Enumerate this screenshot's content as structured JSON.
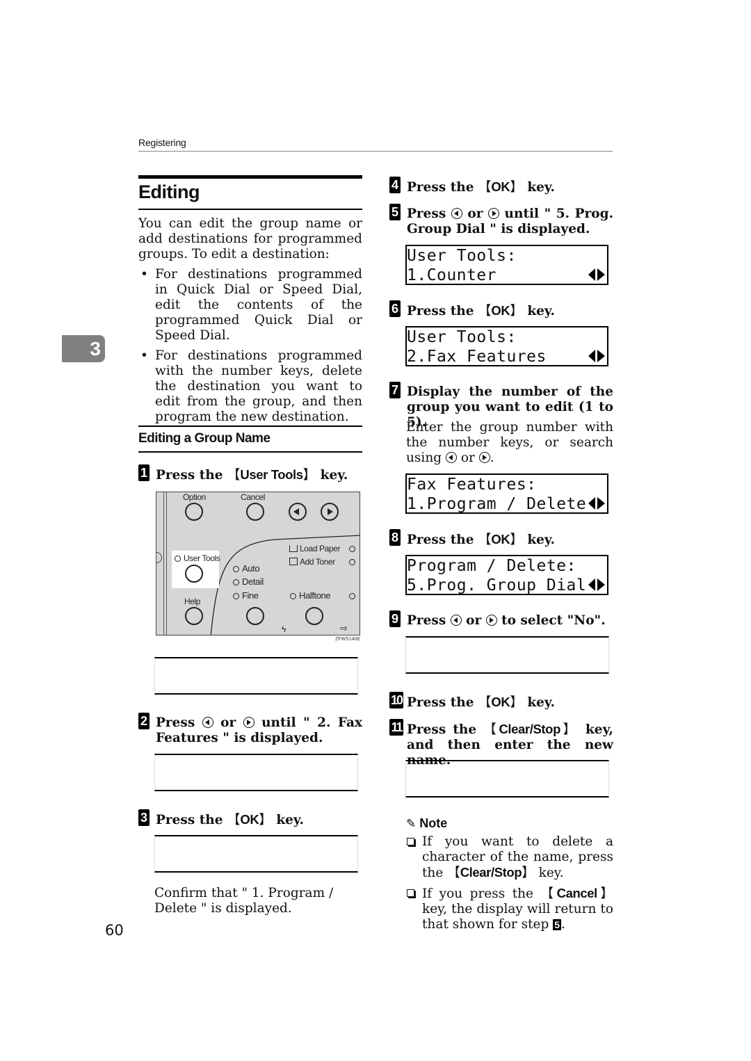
{
  "header": {
    "running_head": "Registering"
  },
  "chapter_tab": "3",
  "section": {
    "title": "Editing",
    "intro": "You can edit the group name or add destinations for programmed groups. To edit a destination:",
    "bullets": [
      "For destinations programmed in Quick Dial or Speed Dial, edit the contents of the programmed Quick Dial or Speed Dial.",
      "For destinations programmed with the number keys, delete the destination you want to edit from the group, and then program the new destination."
    ]
  },
  "subsection": {
    "title": "Editing a Group Name"
  },
  "keys": {
    "user_tools": "User Tools",
    "ok": "OK",
    "clear_stop": "Clear/Stop",
    "cancel": "Cancel",
    "bracket_open": "【",
    "bracket_close": "】"
  },
  "steps": [
    {
      "num": "1",
      "pre": "Press the ",
      "key": "User Tools",
      "post": " key."
    },
    {
      "num": "2",
      "pre": "Press ",
      "mid": " or ",
      "post": " until \" 2. Fax Features \" is displayed."
    },
    {
      "num": "3",
      "pre": "Press the ",
      "key": "OK",
      "post": " key.",
      "note": "Confirm that \" 1. Program / Delete \" is displayed."
    },
    {
      "num": "4",
      "pre": "Press the ",
      "key": "OK",
      "post": " key."
    },
    {
      "num": "5",
      "pre": "Press ",
      "mid": " or ",
      "post": " until \" 5. Prog. Group Dial \" is displayed."
    },
    {
      "num": "6",
      "pre": "Press the ",
      "key": "OK",
      "post": " key."
    },
    {
      "num": "7",
      "text": "Display the number of the group you want to edit (1 to 5).",
      "note_pre": "Enter the group number with the number keys, or search using ",
      "note_mid": " or ",
      "note_post": "."
    },
    {
      "num": "8",
      "pre": "Press the ",
      "key": "OK",
      "post": " key."
    },
    {
      "num": "9",
      "pre": "Press ",
      "mid": " or ",
      "post": " to select \"No\"."
    },
    {
      "num": "10",
      "pre": "Press the ",
      "key": "OK",
      "post": " key."
    },
    {
      "num": "11",
      "pre": "Press the ",
      "key": "Clear/Stop",
      "post": " key, and then enter the new name."
    }
  ],
  "lcd_screens": [
    {
      "line1": "User Tools:",
      "line2": "1.Counter"
    },
    {
      "line1": "User Tools:",
      "line2": "2.Fax Features"
    },
    {
      "line1": "Fax Features:",
      "line2": "1.Program / Delete"
    },
    {
      "line1": "Program / Delete:",
      "line2": "5.Prog. Group Dial"
    }
  ],
  "control_panel": {
    "labels": {
      "option": "Option",
      "cancel": "Cancel",
      "user_tools": "User Tools",
      "help": "Help",
      "auto": "Auto",
      "detail": "Detail",
      "fine": "Fine",
      "halftone": "Halftone",
      "load_paper": "Load Paper",
      "add_toner": "Add Toner"
    },
    "caption": "ZFWS140E"
  },
  "note": {
    "title": "Note",
    "items": [
      {
        "pre": "If you want to delete a character of the name, press the ",
        "key": "Clear/Stop",
        "post": " key."
      },
      {
        "pre": "If you press the ",
        "key": "Cancel",
        "post": " key, the display will return to that shown for step ",
        "ref": "5",
        "end": "."
      }
    ]
  },
  "page_number": "60"
}
